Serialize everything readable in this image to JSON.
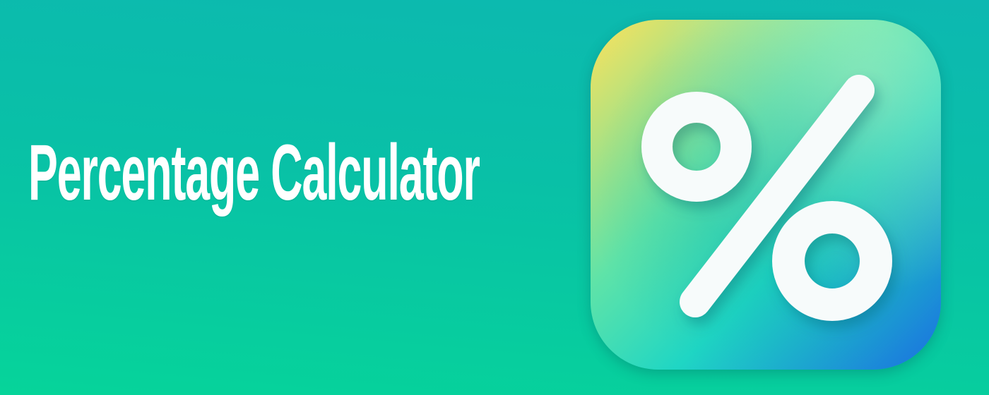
{
  "banner": {
    "title": "Percentage Calculator"
  },
  "icon": {
    "name": "percent-icon",
    "symbol": "%"
  },
  "colors": {
    "background_top": "#0db8b1",
    "background_bottom": "#06d49a",
    "title_text": "#ffffff",
    "icon_yellow": "#ffe15a",
    "icon_green": "#36dcb0",
    "icon_blue": "#1a7fdc",
    "glyph": "#f7fbfb"
  }
}
